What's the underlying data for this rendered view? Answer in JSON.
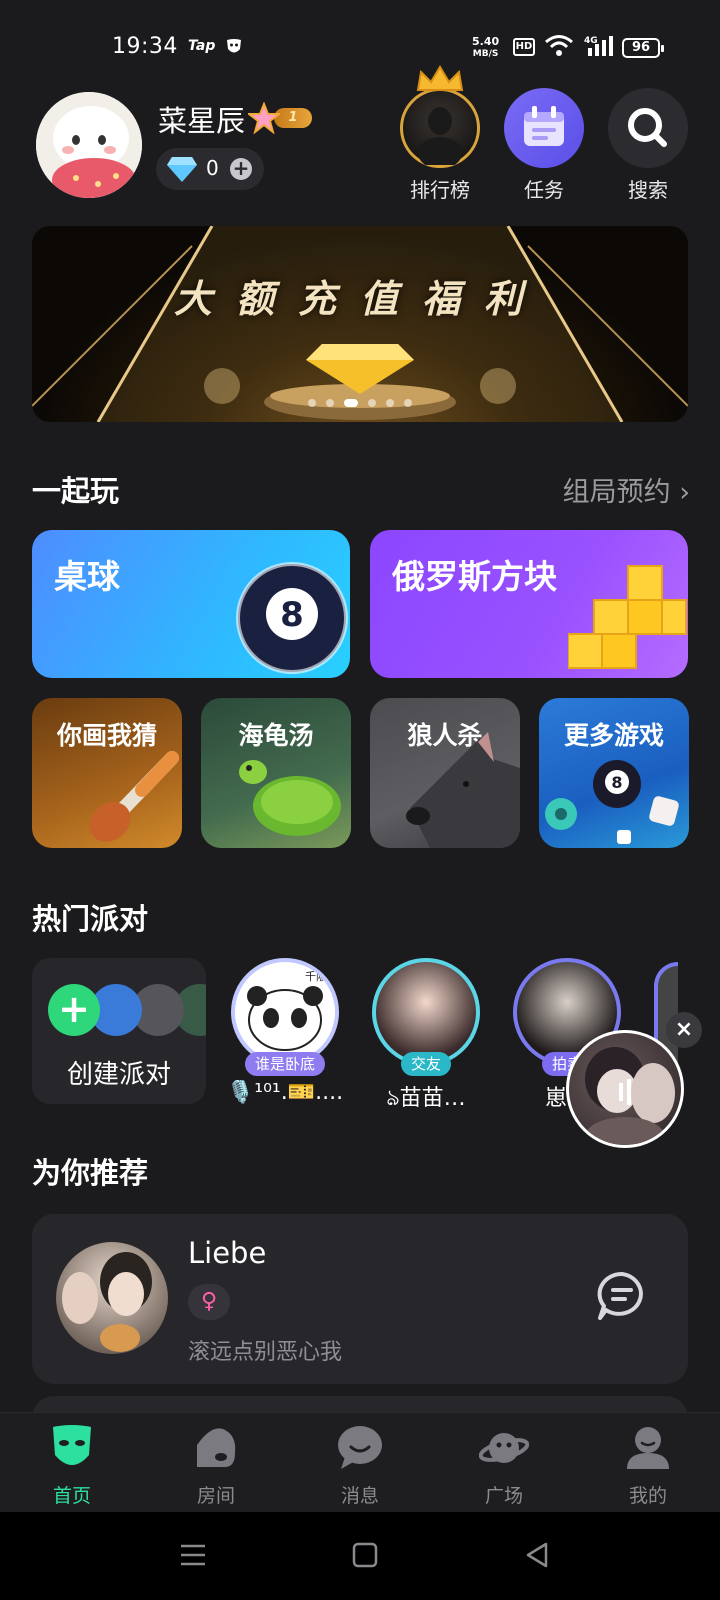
{
  "status_bar": {
    "time": "19:34",
    "app_label": "Tap",
    "net_speed_value": "5.40",
    "net_speed_unit": "MB/S",
    "hd": "HD",
    "network": "4G",
    "battery": "96"
  },
  "header": {
    "username": "菜星辰",
    "level": "1",
    "diamonds": "0",
    "buttons": [
      {
        "label": "排行榜",
        "icon": "crown-avatar-icon"
      },
      {
        "label": "任务",
        "icon": "calendar-icon"
      },
      {
        "label": "搜索",
        "icon": "search-icon"
      }
    ]
  },
  "banner": {
    "title": "大额充值福利",
    "slides": 6,
    "active_slide": 3
  },
  "play_together": {
    "title": "一起玩",
    "more_label": "组局预约",
    "big_games": [
      {
        "name": "桌球"
      },
      {
        "name": "俄罗斯方块"
      }
    ],
    "small_games": [
      {
        "name": "你画我猜"
      },
      {
        "name": "海龟汤"
      },
      {
        "name": "狼人杀"
      },
      {
        "name": "更多游戏"
      }
    ]
  },
  "hot_party": {
    "title": "热门派对",
    "create_label": "创建派对",
    "rooms": [
      {
        "tag": "谁是卧底",
        "name": "🎙️¹⁰¹.🎫....",
        "avatar_text": "千阪!"
      },
      {
        "tag": "交友",
        "name": "ঌ苗苗…"
      },
      {
        "tag": "拍卖",
        "name": "崽崽"
      }
    ]
  },
  "recommend": {
    "title": "为你推荐",
    "users": [
      {
        "name": "Liebe",
        "gender": "♀",
        "signature": "滚远点别恶心我"
      }
    ]
  },
  "tabbar": {
    "tabs": [
      {
        "label": "首页",
        "icon": "mask-icon",
        "active": true
      },
      {
        "label": "房间",
        "icon": "room-icon",
        "active": false
      },
      {
        "label": "消息",
        "icon": "message-icon",
        "active": false
      },
      {
        "label": "广场",
        "icon": "planet-icon",
        "active": false
      },
      {
        "label": "我的",
        "icon": "profile-icon",
        "active": false
      }
    ]
  },
  "colors": {
    "background": "#1b1b1d",
    "accent": "#2ee0a0",
    "card": "#27272b"
  }
}
